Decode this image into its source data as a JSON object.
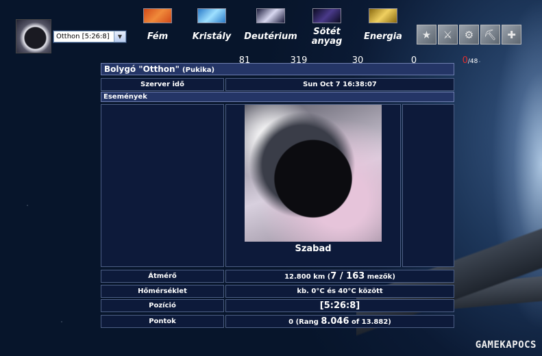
{
  "planet_selector": {
    "value": "Otthon [5:26:8]"
  },
  "resources": [
    {
      "icon": "metal-icon",
      "name": "Fém",
      "value": "81",
      "colors": [
        "#d14a1a",
        "#f08a3a"
      ]
    },
    {
      "icon": "crystal-icon",
      "name": "Kristály",
      "value": "319",
      "colors": [
        "#2a7ac8",
        "#9ee0ff"
      ]
    },
    {
      "icon": "deuterium-icon",
      "name": "Deutérium",
      "value": "30",
      "colors": [
        "#1a1a3a",
        "#d8d8f0"
      ]
    },
    {
      "icon": "dark-matter-icon",
      "name": "Sötét anyag",
      "value": "0",
      "colors": [
        "#0a0a20",
        "#4a3a8a"
      ]
    },
    {
      "icon": "energy-icon",
      "name": "Energia",
      "value_current": "0",
      "value_max": "/48",
      "colors": [
        "#8a6a10",
        "#f0d060"
      ]
    }
  ],
  "officers": [
    "commander-icon",
    "admiral-icon",
    "engineer-icon",
    "geologist-icon",
    "technocrat-icon"
  ],
  "overview": {
    "title": "Bolygó \"Otthon\"",
    "player": "(Pukika)",
    "server_time_label": "Szerver idő",
    "server_time": "Sun Oct 7 16:38:07",
    "events_label": "Események",
    "planet_status": "Szabad",
    "diameter_label": "Átmérő",
    "diameter_value": "12.800 km (",
    "fields_used": "7",
    "fields_sep": " / ",
    "fields_max": "163",
    "fields_suffix": " mezők)",
    "temperature_label": "Hőmérséklet",
    "temperature_value": "kb. 0°C és 40°C között",
    "position_label": "Pozíció",
    "position_value": "[5:26:8]",
    "points_label": "Pontok",
    "points_prefix": "0 (Rang ",
    "rank": "8.046",
    "points_suffix": " of 13.882)"
  },
  "watermark": "GAMEKAPOCS"
}
